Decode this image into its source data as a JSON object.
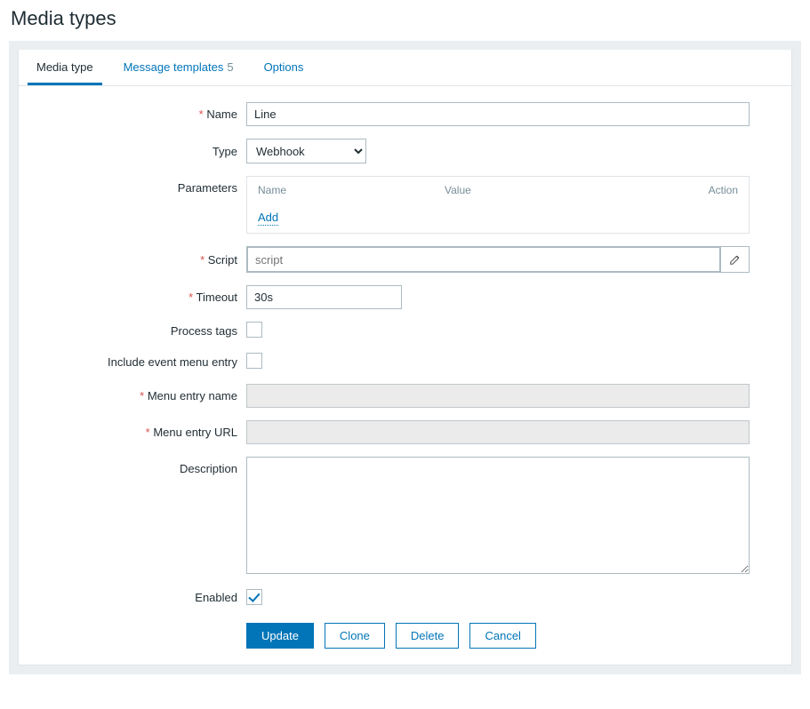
{
  "page_title": "Media types",
  "tabs": [
    {
      "label": "Media type",
      "active": true
    },
    {
      "label": "Message templates",
      "count": "5",
      "active": false
    },
    {
      "label": "Options",
      "active": false
    }
  ],
  "labels": {
    "name": "Name",
    "type": "Type",
    "parameters": "Parameters",
    "script": "Script",
    "timeout": "Timeout",
    "process_tags": "Process tags",
    "include_event_menu": "Include event menu entry",
    "menu_entry_name": "Menu entry name",
    "menu_entry_url": "Menu entry URL",
    "description": "Description",
    "enabled": "Enabled"
  },
  "params_header": {
    "name": "Name",
    "value": "Value",
    "action": "Action"
  },
  "params_add": "Add",
  "form": {
    "name": "Line",
    "type": "Webhook",
    "script_placeholder": "script",
    "timeout": "30s",
    "process_tags": false,
    "include_event_menu": false,
    "menu_entry_name": "",
    "menu_entry_url": "",
    "description": "",
    "enabled": true
  },
  "buttons": {
    "update": "Update",
    "clone": "Clone",
    "delete": "Delete",
    "cancel": "Cancel"
  }
}
